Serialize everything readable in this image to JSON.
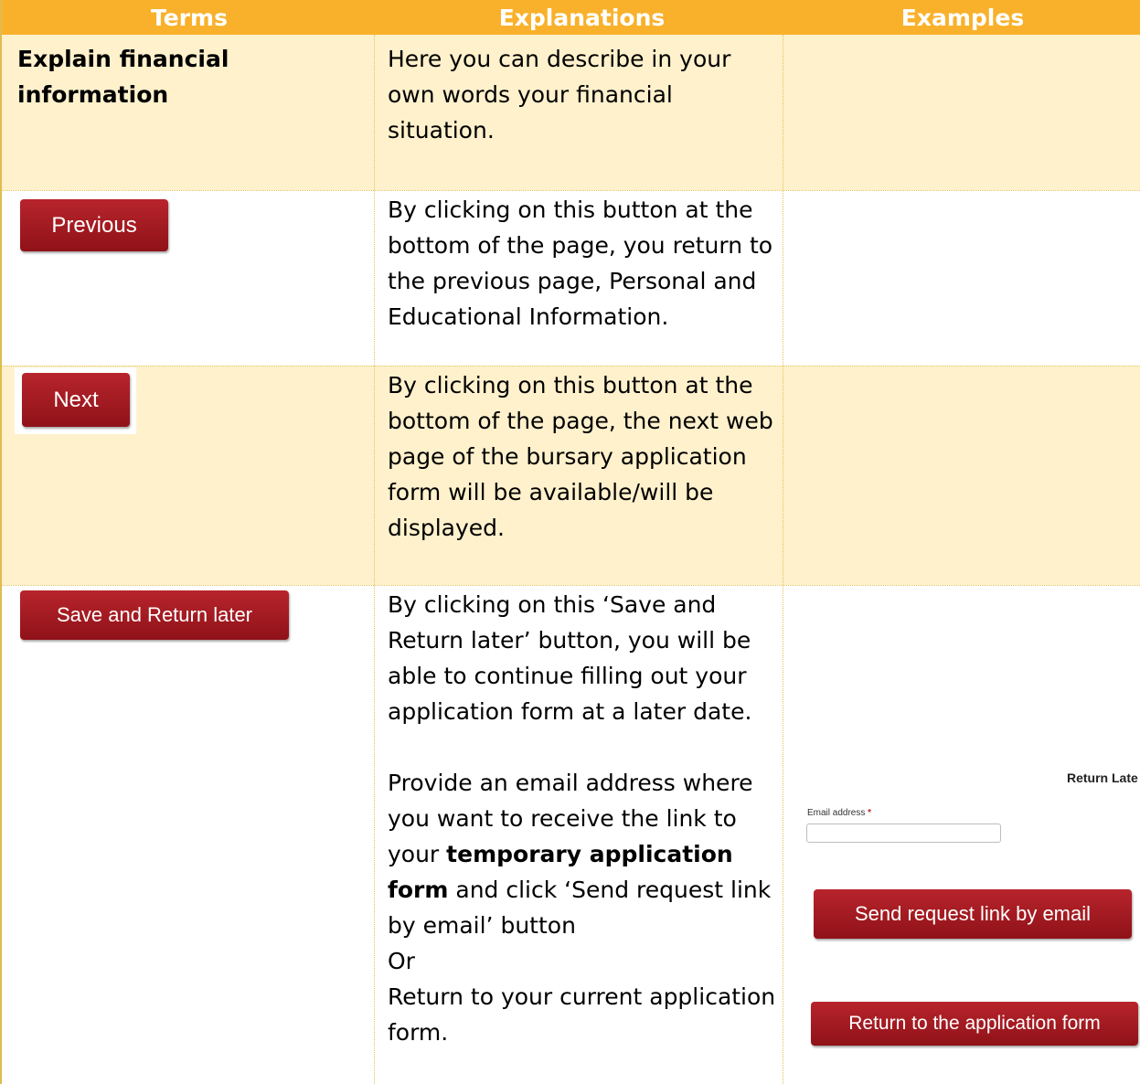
{
  "header": {
    "terms": "Terms",
    "explanations": "Explanations",
    "examples": "Examples"
  },
  "rows": [
    {
      "term": "Explain financial information",
      "explanation": "Here you can describe in your own words your financial situation."
    },
    {
      "button_label": "Previous",
      "explanation": "By clicking on this button at the bottom of the page, you return to the previous page, Personal and Educational Information."
    },
    {
      "button_label": "Next",
      "explanation": "By clicking on this button at the bottom of the page, the next web page of the bursary application form will be available/will be displayed."
    },
    {
      "button_label": "Save and Return later",
      "explanation_1": "By clicking on this ‘Save and Return later’ button, you will be able to continue filling out your application form at a later date.",
      "explanation_2_pre": "Provide an email address where you want to receive the link to your ",
      "explanation_2_bold": "temporary application form",
      "explanation_2_post": " and click ‘Send request link by email’ button",
      "explanation_or": "Or",
      "explanation_3": "Return to your current application form.",
      "example": {
        "heading": "Return Late",
        "email_label": "Email address",
        "required_marker": "*",
        "send_button": "Send request link by email",
        "return_button": "Return to the application form"
      }
    }
  ],
  "colors": {
    "header_bg": "#f9b12b",
    "row_shade": "#fff1cc",
    "button_red": "#a01a20"
  }
}
